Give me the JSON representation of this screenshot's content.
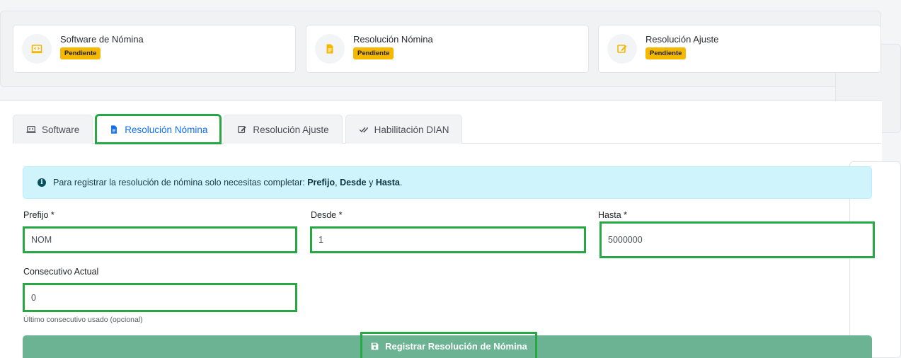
{
  "status_cards": [
    {
      "title": "Software de Nómina",
      "badge": "Pendiente",
      "icon": "code-window-icon"
    },
    {
      "title": "Resolución Nómina",
      "badge": "Pendiente",
      "icon": "document-icon"
    },
    {
      "title": "Resolución Ajuste",
      "badge": "Pendiente",
      "icon": "edit-icon"
    }
  ],
  "tabs": [
    {
      "label": "Software",
      "icon": "code-window-icon"
    },
    {
      "label": "Resolución Nómina",
      "icon": "document-icon",
      "active": true
    },
    {
      "label": "Resolución Ajuste",
      "icon": "edit-icon"
    },
    {
      "label": "Habilitación DIAN",
      "icon": "double-check-icon"
    }
  ],
  "alert": {
    "prefix": "Para registrar la resolución de nómina solo necesitas completar: ",
    "field1": "Prefijo",
    "sep1": ", ",
    "field2": "Desde",
    "sep2": " y ",
    "field3": "Hasta",
    "suffix": "."
  },
  "form": {
    "prefijo": {
      "label": "Prefijo *",
      "value": "NOM"
    },
    "desde": {
      "label": "Desde *",
      "value": "1"
    },
    "hasta": {
      "label": "Hasta *",
      "value": "5000000"
    },
    "consecutivo": {
      "label": "Consecutivo Actual",
      "value": "0",
      "help": "Último consecutivo usado (opcional)"
    }
  },
  "submit": {
    "label": "Registrar Resolución de Nómina",
    "icon": "save-icon"
  },
  "colors": {
    "badge": "#f5b800",
    "active_tab": "#0d6efd",
    "highlight": "#28a745",
    "submit": "#6bb392",
    "alert_bg": "#cff4fc",
    "icon_yellow": "#f5b800"
  }
}
